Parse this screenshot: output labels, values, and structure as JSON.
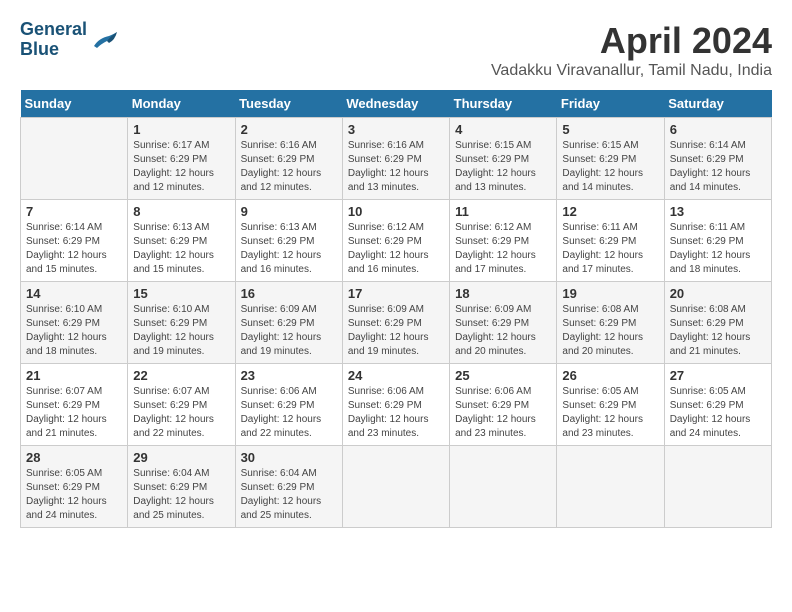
{
  "header": {
    "logo_line1": "General",
    "logo_line2": "Blue",
    "month_year": "April 2024",
    "location": "Vadakku Viravanallur, Tamil Nadu, India"
  },
  "days_of_week": [
    "Sunday",
    "Monday",
    "Tuesday",
    "Wednesday",
    "Thursday",
    "Friday",
    "Saturday"
  ],
  "weeks": [
    {
      "days": [
        {
          "number": "",
          "info": ""
        },
        {
          "number": "1",
          "info": "Sunrise: 6:17 AM\nSunset: 6:29 PM\nDaylight: 12 hours\nand 12 minutes."
        },
        {
          "number": "2",
          "info": "Sunrise: 6:16 AM\nSunset: 6:29 PM\nDaylight: 12 hours\nand 12 minutes."
        },
        {
          "number": "3",
          "info": "Sunrise: 6:16 AM\nSunset: 6:29 PM\nDaylight: 12 hours\nand 13 minutes."
        },
        {
          "number": "4",
          "info": "Sunrise: 6:15 AM\nSunset: 6:29 PM\nDaylight: 12 hours\nand 13 minutes."
        },
        {
          "number": "5",
          "info": "Sunrise: 6:15 AM\nSunset: 6:29 PM\nDaylight: 12 hours\nand 14 minutes."
        },
        {
          "number": "6",
          "info": "Sunrise: 6:14 AM\nSunset: 6:29 PM\nDaylight: 12 hours\nand 14 minutes."
        }
      ]
    },
    {
      "days": [
        {
          "number": "7",
          "info": "Sunrise: 6:14 AM\nSunset: 6:29 PM\nDaylight: 12 hours\nand 15 minutes."
        },
        {
          "number": "8",
          "info": "Sunrise: 6:13 AM\nSunset: 6:29 PM\nDaylight: 12 hours\nand 15 minutes."
        },
        {
          "number": "9",
          "info": "Sunrise: 6:13 AM\nSunset: 6:29 PM\nDaylight: 12 hours\nand 16 minutes."
        },
        {
          "number": "10",
          "info": "Sunrise: 6:12 AM\nSunset: 6:29 PM\nDaylight: 12 hours\nand 16 minutes."
        },
        {
          "number": "11",
          "info": "Sunrise: 6:12 AM\nSunset: 6:29 PM\nDaylight: 12 hours\nand 17 minutes."
        },
        {
          "number": "12",
          "info": "Sunrise: 6:11 AM\nSunset: 6:29 PM\nDaylight: 12 hours\nand 17 minutes."
        },
        {
          "number": "13",
          "info": "Sunrise: 6:11 AM\nSunset: 6:29 PM\nDaylight: 12 hours\nand 18 minutes."
        }
      ]
    },
    {
      "days": [
        {
          "number": "14",
          "info": "Sunrise: 6:10 AM\nSunset: 6:29 PM\nDaylight: 12 hours\nand 18 minutes."
        },
        {
          "number": "15",
          "info": "Sunrise: 6:10 AM\nSunset: 6:29 PM\nDaylight: 12 hours\nand 19 minutes."
        },
        {
          "number": "16",
          "info": "Sunrise: 6:09 AM\nSunset: 6:29 PM\nDaylight: 12 hours\nand 19 minutes."
        },
        {
          "number": "17",
          "info": "Sunrise: 6:09 AM\nSunset: 6:29 PM\nDaylight: 12 hours\nand 19 minutes."
        },
        {
          "number": "18",
          "info": "Sunrise: 6:09 AM\nSunset: 6:29 PM\nDaylight: 12 hours\nand 20 minutes."
        },
        {
          "number": "19",
          "info": "Sunrise: 6:08 AM\nSunset: 6:29 PM\nDaylight: 12 hours\nand 20 minutes."
        },
        {
          "number": "20",
          "info": "Sunrise: 6:08 AM\nSunset: 6:29 PM\nDaylight: 12 hours\nand 21 minutes."
        }
      ]
    },
    {
      "days": [
        {
          "number": "21",
          "info": "Sunrise: 6:07 AM\nSunset: 6:29 PM\nDaylight: 12 hours\nand 21 minutes."
        },
        {
          "number": "22",
          "info": "Sunrise: 6:07 AM\nSunset: 6:29 PM\nDaylight: 12 hours\nand 22 minutes."
        },
        {
          "number": "23",
          "info": "Sunrise: 6:06 AM\nSunset: 6:29 PM\nDaylight: 12 hours\nand 22 minutes."
        },
        {
          "number": "24",
          "info": "Sunrise: 6:06 AM\nSunset: 6:29 PM\nDaylight: 12 hours\nand 23 minutes."
        },
        {
          "number": "25",
          "info": "Sunrise: 6:06 AM\nSunset: 6:29 PM\nDaylight: 12 hours\nand 23 minutes."
        },
        {
          "number": "26",
          "info": "Sunrise: 6:05 AM\nSunset: 6:29 PM\nDaylight: 12 hours\nand 23 minutes."
        },
        {
          "number": "27",
          "info": "Sunrise: 6:05 AM\nSunset: 6:29 PM\nDaylight: 12 hours\nand 24 minutes."
        }
      ]
    },
    {
      "days": [
        {
          "number": "28",
          "info": "Sunrise: 6:05 AM\nSunset: 6:29 PM\nDaylight: 12 hours\nand 24 minutes."
        },
        {
          "number": "29",
          "info": "Sunrise: 6:04 AM\nSunset: 6:29 PM\nDaylight: 12 hours\nand 25 minutes."
        },
        {
          "number": "30",
          "info": "Sunrise: 6:04 AM\nSunset: 6:29 PM\nDaylight: 12 hours\nand 25 minutes."
        },
        {
          "number": "",
          "info": ""
        },
        {
          "number": "",
          "info": ""
        },
        {
          "number": "",
          "info": ""
        },
        {
          "number": "",
          "info": ""
        }
      ]
    }
  ]
}
